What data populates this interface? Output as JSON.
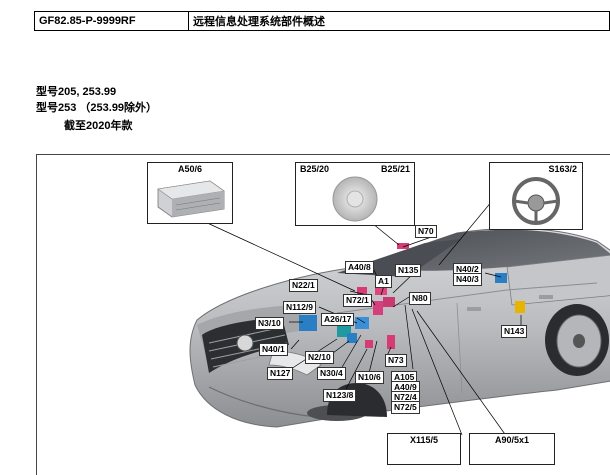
{
  "header": {
    "doc_number": "GF82.85-P-9999RF",
    "doc_title": "远程信息处理系统部件概述"
  },
  "applicability": {
    "line1": "型号205, 253.99",
    "line2": "型号253 （253.99除外）",
    "line3": "截至2020年款"
  },
  "figure": {
    "callouts": {
      "a50_6": "A50/6",
      "b25_20": "B25/20",
      "b25_21": "B25/21",
      "s163_2": "S163/2",
      "x115_5": "X115/5",
      "a90_5x1": "A90/5x1"
    },
    "labels": {
      "n70": "N70",
      "a40_8": "A40/8",
      "n135": "N135",
      "n40_2": "N40/2",
      "n40_3": "N40/3",
      "n22_1": "N22/1",
      "a1": "A1",
      "n72_1": "N72/1",
      "n80": "N80",
      "n112_9": "N112/9",
      "a26_17": "A26/17",
      "n3_10": "N3/10",
      "n143": "N143",
      "n40_1": "N40/1",
      "n2_10": "N2/10",
      "n127": "N127",
      "n30_4": "N30/4",
      "n10_6": "N10/6",
      "n73": "N73",
      "n123_8": "N123/8",
      "a105": "A105",
      "a40_9": "A40/9",
      "n72_4": "N72/4",
      "n72_5": "N72/5"
    }
  }
}
